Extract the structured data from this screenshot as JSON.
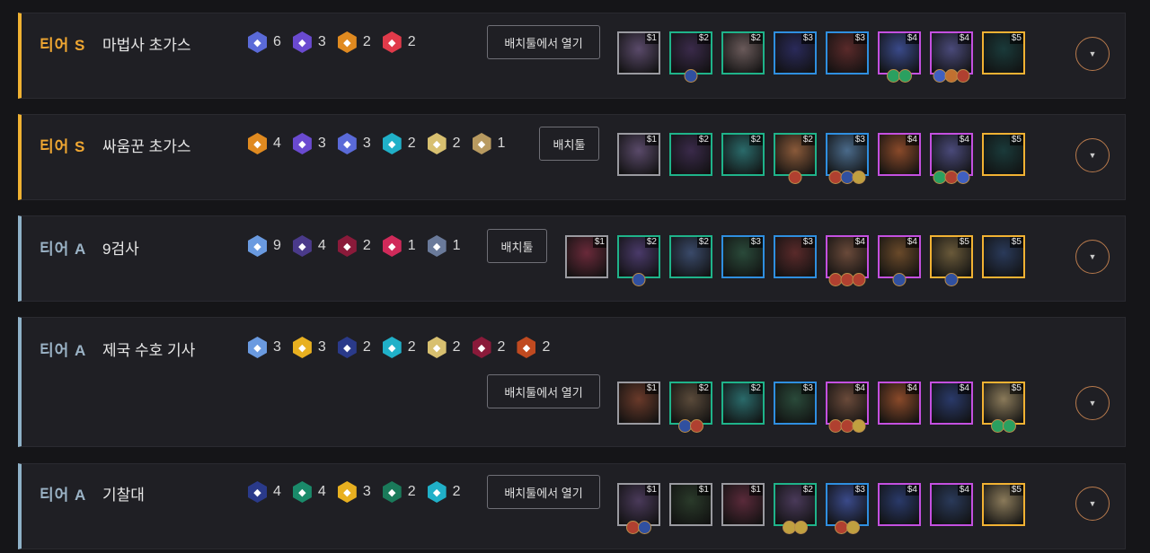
{
  "comps": [
    {
      "tier": "티어 S",
      "name": "마법사 초가스",
      "tier_class": "s",
      "button": "배치툴에서 열기",
      "synergies": [
        {
          "icon": "book-icon",
          "color": "#5a6ad8",
          "count": "6"
        },
        {
          "icon": "swirl-icon",
          "color": "#6a4ad0",
          "count": "3"
        },
        {
          "icon": "chest-icon",
          "color": "#e08a20",
          "count": "2"
        },
        {
          "icon": "wing-icon",
          "color": "#e03a4a",
          "count": "2"
        }
      ],
      "champions": [
        {
          "cost": "$1",
          "tier": "c1",
          "color": "#5a4a6a",
          "items": []
        },
        {
          "cost": "$2",
          "tier": "c2",
          "color": "#3a2a4a",
          "items": [
            "#3050a0"
          ]
        },
        {
          "cost": "$2",
          "tier": "c2",
          "color": "#6a5a5a",
          "items": []
        },
        {
          "cost": "$3",
          "tier": "c3",
          "color": "#2a2a5a",
          "items": []
        },
        {
          "cost": "$3",
          "tier": "c3",
          "color": "#5a2a2a",
          "items": []
        },
        {
          "cost": "$4",
          "tier": "c4",
          "color": "#3a4a8a",
          "items": [
            "#2aa060",
            "#2aa060"
          ]
        },
        {
          "cost": "$4",
          "tier": "c4",
          "color": "#4a4a7a",
          "items": [
            "#4060c0",
            "#c07030",
            "#b04030"
          ]
        },
        {
          "cost": "$5",
          "tier": "c5",
          "color": "#1a3a3a",
          "items": []
        }
      ]
    },
    {
      "tier": "티어 S",
      "name": "싸움꾼 초가스",
      "tier_class": "s",
      "button": "배치툴",
      "synergies": [
        {
          "icon": "fist-icon",
          "color": "#e08a20",
          "count": "4"
        },
        {
          "icon": "swirl-icon",
          "color": "#6a4ad0",
          "count": "3"
        },
        {
          "icon": "book-icon",
          "color": "#5a6ad8",
          "count": "3"
        },
        {
          "icon": "snowflake-icon",
          "color": "#20b0c8",
          "count": "2"
        },
        {
          "icon": "shield-icon",
          "color": "#d8c070",
          "count": "2"
        },
        {
          "icon": "helmet-icon",
          "color": "#b89a60",
          "count": "1"
        }
      ],
      "champions": [
        {
          "cost": "$1",
          "tier": "c1",
          "color": "#5a4a6a",
          "items": []
        },
        {
          "cost": "$2",
          "tier": "c2",
          "color": "#3a2a4a",
          "items": []
        },
        {
          "cost": "$2",
          "tier": "c2",
          "color": "#2a6a6a",
          "items": []
        },
        {
          "cost": "$2",
          "tier": "c2",
          "color": "#8a5a3a",
          "items": [
            "#b04030"
          ]
        },
        {
          "cost": "$3",
          "tier": "c3",
          "color": "#4a6a8a",
          "items": [
            "#b04030",
            "#3050a0",
            "#c0a040"
          ]
        },
        {
          "cost": "$4",
          "tier": "c4",
          "color": "#8a4a2a",
          "items": []
        },
        {
          "cost": "$4",
          "tier": "c4",
          "color": "#4a4a7a",
          "items": [
            "#2aa060",
            "#b04030",
            "#4060c0"
          ]
        },
        {
          "cost": "$5",
          "tier": "c5",
          "color": "#1a3a3a",
          "items": []
        }
      ]
    },
    {
      "tier": "티어 A",
      "name": "9검사",
      "tier_class": "a",
      "button": "배치툴",
      "synergies": [
        {
          "icon": "sword-icon",
          "color": "#6a9ae0",
          "count": "9"
        },
        {
          "icon": "horns-icon",
          "color": "#4a3a8a",
          "count": "4"
        },
        {
          "icon": "banner-icon",
          "color": "#8a1a3a",
          "count": "2"
        },
        {
          "icon": "cross-icon",
          "color": "#d02a5a",
          "count": "1"
        },
        {
          "icon": "eye-icon",
          "color": "#6a7a9a",
          "count": "1"
        }
      ],
      "champions": [
        {
          "cost": "$1",
          "tier": "c1",
          "color": "#6a2a3a",
          "items": []
        },
        {
          "cost": "$2",
          "tier": "c2",
          "color": "#4a3a6a",
          "items": [
            "#3050a0"
          ]
        },
        {
          "cost": "$2",
          "tier": "c2",
          "color": "#3a4a6a",
          "items": []
        },
        {
          "cost": "$3",
          "tier": "c3",
          "color": "#2a4a3a",
          "items": []
        },
        {
          "cost": "$3",
          "tier": "c3",
          "color": "#5a2a2a",
          "items": []
        },
        {
          "cost": "$4",
          "tier": "c4",
          "color": "#6a4a3a",
          "items": [
            "#b04030",
            "#b04030",
            "#b04030"
          ]
        },
        {
          "cost": "$4",
          "tier": "c4",
          "color": "#6a4a2a",
          "items": [
            "#3050a0"
          ]
        },
        {
          "cost": "$5",
          "tier": "c5",
          "color": "#6a5a3a",
          "items": [
            "#3050a0"
          ]
        },
        {
          "cost": "$5",
          "tier": "c5",
          "color": "#2a3a5a",
          "items": []
        }
      ]
    },
    {
      "tier": "티어 A",
      "name": "제국 수호 기사",
      "tier_class": "a",
      "button": "배치툴에서 열기",
      "synergies": [
        {
          "icon": "sword-icon",
          "color": "#6a9ae0",
          "count": "3"
        },
        {
          "icon": "crown-icon",
          "color": "#e8b020",
          "count": "3"
        },
        {
          "icon": "crest-icon",
          "color": "#2a3a8a",
          "count": "2"
        },
        {
          "icon": "snowflake-icon",
          "color": "#20b0c8",
          "count": "2"
        },
        {
          "icon": "shield-icon",
          "color": "#d8c070",
          "count": "2"
        },
        {
          "icon": "banner-icon",
          "color": "#8a1a3a",
          "count": "2"
        },
        {
          "icon": "flame-icon",
          "color": "#c04a20",
          "count": "2"
        }
      ],
      "champions": [
        {
          "cost": "$1",
          "tier": "c1",
          "color": "#6a3a2a",
          "items": []
        },
        {
          "cost": "$2",
          "tier": "c2",
          "color": "#5a4a3a",
          "items": [
            "#3050a0",
            "#b04030"
          ]
        },
        {
          "cost": "$2",
          "tier": "c2",
          "color": "#2a6a6a",
          "items": []
        },
        {
          "cost": "$3",
          "tier": "c3",
          "color": "#2a4a3a",
          "items": []
        },
        {
          "cost": "$4",
          "tier": "c4",
          "color": "#6a4a3a",
          "items": [
            "#b04030",
            "#b04030",
            "#c0a040"
          ]
        },
        {
          "cost": "$4",
          "tier": "c4",
          "color": "#8a4a2a",
          "items": []
        },
        {
          "cost": "$4",
          "tier": "c4",
          "color": "#2a3a6a",
          "items": []
        },
        {
          "cost": "$5",
          "tier": "c5",
          "color": "#8a7a5a",
          "items": [
            "#2aa060",
            "#2aa060"
          ]
        }
      ]
    },
    {
      "tier": "티어 A",
      "name": "기찰대",
      "tier_class": "a",
      "button": "배치툴에서 열기",
      "synergies": [
        {
          "icon": "crest-icon",
          "color": "#2a3a8a",
          "count": "4"
        },
        {
          "icon": "plane-icon",
          "color": "#1a8a6a",
          "count": "4"
        },
        {
          "icon": "crown-icon",
          "color": "#e8b020",
          "count": "3"
        },
        {
          "icon": "leaf-icon",
          "color": "#1a7a5a",
          "count": "2"
        },
        {
          "icon": "snowflake-icon",
          "color": "#20b0c8",
          "count": "2"
        }
      ],
      "champions": [
        {
          "cost": "$1",
          "tier": "c1",
          "color": "#4a3a5a",
          "items": [
            "#b04030",
            "#3050a0"
          ]
        },
        {
          "cost": "$1",
          "tier": "c1",
          "color": "#2a3a2a",
          "items": []
        },
        {
          "cost": "$1",
          "tier": "c1",
          "color": "#5a2a3a",
          "items": []
        },
        {
          "cost": "$2",
          "tier": "c2",
          "color": "#4a3a5a",
          "items": [
            "#c0a040",
            "#c0a040"
          ]
        },
        {
          "cost": "$3",
          "tier": "c3",
          "color": "#3a4a8a",
          "items": [
            "#b04030",
            "#c0a040"
          ]
        },
        {
          "cost": "$4",
          "tier": "c4",
          "color": "#2a3a6a",
          "items": []
        },
        {
          "cost": "$4",
          "tier": "c4",
          "color": "#2a3a5a",
          "items": []
        },
        {
          "cost": "$5",
          "tier": "c5",
          "color": "#8a7a5a",
          "items": []
        }
      ]
    }
  ]
}
